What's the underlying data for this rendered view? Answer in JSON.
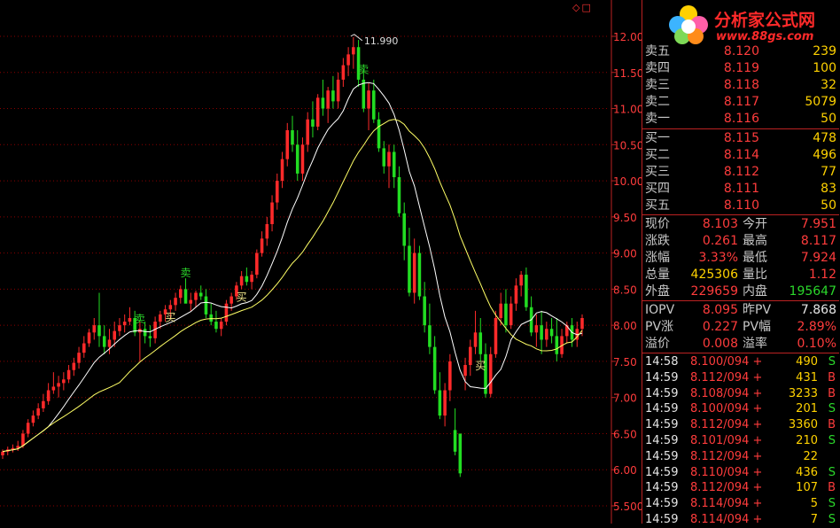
{
  "logo": {
    "title": "分析家公式网",
    "url": "www.88gs.com"
  },
  "header": {
    "top_right_icons": [
      "diamond-icon",
      "square-icon"
    ]
  },
  "chart_data": {
    "type": "candlestick",
    "ylim": [
      5.4,
      12.3
    ],
    "yticks": [
      12.0,
      11.5,
      11.0,
      10.5,
      10.0,
      9.5,
      9.0,
      8.5,
      8.0,
      7.5,
      7.0,
      6.5,
      6.0,
      5.5
    ],
    "ytick_labels": [
      "12.00",
      "11.50",
      "11.00",
      "10.50",
      "10.00",
      "9.50",
      "9.00",
      "8.50",
      "8.00",
      "7.50",
      "7.00",
      "6.50",
      "6.00",
      "5.500"
    ],
    "annotations": [
      {
        "text": "11.990",
        "x": 69,
        "y": 11.99
      },
      {
        "text": "卖",
        "x": 27,
        "y": 8.1,
        "kind": "sell"
      },
      {
        "text": "买",
        "x": 33,
        "y": 8.12,
        "kind": "buy"
      },
      {
        "text": "卖",
        "x": 36,
        "y": 8.74,
        "kind": "sell"
      },
      {
        "text": "买",
        "x": 47,
        "y": 8.4,
        "kind": "buy"
      },
      {
        "text": "卖",
        "x": 71,
        "y": 11.55,
        "kind": "sell"
      },
      {
        "text": "买",
        "x": 94,
        "y": 7.45,
        "kind": "buy"
      }
    ],
    "candles": [
      [
        6.2,
        6.28,
        6.15,
        6.25
      ],
      [
        6.25,
        6.32,
        6.2,
        6.28
      ],
      [
        6.28,
        6.35,
        6.24,
        6.3
      ],
      [
        6.3,
        6.4,
        6.26,
        6.33
      ],
      [
        6.33,
        6.55,
        6.3,
        6.5
      ],
      [
        6.5,
        6.7,
        6.45,
        6.65
      ],
      [
        6.65,
        6.82,
        6.6,
        6.75
      ],
      [
        6.75,
        6.92,
        6.7,
        6.85
      ],
      [
        6.85,
        7.05,
        6.8,
        6.95
      ],
      [
        6.95,
        7.2,
        6.9,
        7.1
      ],
      [
        7.1,
        7.35,
        7.05,
        7.15
      ],
      [
        7.15,
        7.3,
        7.0,
        7.2
      ],
      [
        7.2,
        7.35,
        7.1,
        7.25
      ],
      [
        7.25,
        7.45,
        7.2,
        7.38
      ],
      [
        7.38,
        7.55,
        7.3,
        7.48
      ],
      [
        7.48,
        7.7,
        7.4,
        7.62
      ],
      [
        7.62,
        7.85,
        7.55,
        7.75
      ],
      [
        7.75,
        7.95,
        7.7,
        7.9
      ],
      [
        7.9,
        8.1,
        7.8,
        8.0
      ],
      [
        8.0,
        8.45,
        7.7,
        7.85
      ],
      [
        7.85,
        8.0,
        7.6,
        7.7
      ],
      [
        7.7,
        7.95,
        7.6,
        7.8
      ],
      [
        7.8,
        8.05,
        7.7,
        7.92
      ],
      [
        7.92,
        8.1,
        7.85,
        8.0
      ],
      [
        8.0,
        8.15,
        7.9,
        8.05
      ],
      [
        8.05,
        8.25,
        8.0,
        8.1
      ],
      [
        8.1,
        8.2,
        7.85,
        7.9
      ],
      [
        7.9,
        8.05,
        7.5,
        7.95
      ],
      [
        7.95,
        8.05,
        7.75,
        7.85
      ],
      [
        7.85,
        8.0,
        7.7,
        7.82
      ],
      [
        7.82,
        8.12,
        7.75,
        8.05
      ],
      [
        8.05,
        8.2,
        7.95,
        8.15
      ],
      [
        8.15,
        8.28,
        8.05,
        8.22
      ],
      [
        8.22,
        8.35,
        8.1,
        8.28
      ],
      [
        8.28,
        8.45,
        8.2,
        8.38
      ],
      [
        8.38,
        8.55,
        8.3,
        8.5
      ],
      [
        8.5,
        8.65,
        8.4,
        8.3
      ],
      [
        8.3,
        8.45,
        8.2,
        8.35
      ],
      [
        8.35,
        8.48,
        8.25,
        8.45
      ],
      [
        8.45,
        8.55,
        8.35,
        8.4
      ],
      [
        8.4,
        8.5,
        8.1,
        8.15
      ],
      [
        8.15,
        8.3,
        8.0,
        8.05
      ],
      [
        8.05,
        8.2,
        7.9,
        7.95
      ],
      [
        7.95,
        8.1,
        7.85,
        8.05
      ],
      [
        8.05,
        8.35,
        8.0,
        8.3
      ],
      [
        8.3,
        8.45,
        8.2,
        8.4
      ],
      [
        8.4,
        8.6,
        8.35,
        8.55
      ],
      [
        8.55,
        8.75,
        8.5,
        8.68
      ],
      [
        8.68,
        8.8,
        8.55,
        8.6
      ],
      [
        8.6,
        8.75,
        8.5,
        8.7
      ],
      [
        8.7,
        9.05,
        8.65,
        9.0
      ],
      [
        9.0,
        9.3,
        8.95,
        9.2
      ],
      [
        9.2,
        9.5,
        9.1,
        9.4
      ],
      [
        9.4,
        9.8,
        9.3,
        9.7
      ],
      [
        9.7,
        10.1,
        9.6,
        10.0
      ],
      [
        10.0,
        10.4,
        9.9,
        10.3
      ],
      [
        10.3,
        10.8,
        10.2,
        10.7
      ],
      [
        10.7,
        10.9,
        10.4,
        10.5
      ],
      [
        10.5,
        10.7,
        10.0,
        10.1
      ],
      [
        10.1,
        10.6,
        10.0,
        10.5
      ],
      [
        10.5,
        10.95,
        10.4,
        10.85
      ],
      [
        10.85,
        11.1,
        10.6,
        10.75
      ],
      [
        10.75,
        11.2,
        10.7,
        11.15
      ],
      [
        11.15,
        11.4,
        10.9,
        11.0
      ],
      [
        11.0,
        11.3,
        10.8,
        11.25
      ],
      [
        11.25,
        11.45,
        11.0,
        11.1
      ],
      [
        11.1,
        11.5,
        11.0,
        11.4
      ],
      [
        11.4,
        11.7,
        11.3,
        11.6
      ],
      [
        11.6,
        11.85,
        11.45,
        11.75
      ],
      [
        11.75,
        11.99,
        11.55,
        11.85
      ],
      [
        11.85,
        11.95,
        11.3,
        11.4
      ],
      [
        11.4,
        11.55,
        10.95,
        11.0
      ],
      [
        11.0,
        11.35,
        10.7,
        11.25
      ],
      [
        11.25,
        11.4,
        10.8,
        10.85
      ],
      [
        10.85,
        10.95,
        10.4,
        10.45
      ],
      [
        10.45,
        10.55,
        10.1,
        10.2
      ],
      [
        10.2,
        10.5,
        9.9,
        10.4
      ],
      [
        10.4,
        10.5,
        9.9,
        10.05
      ],
      [
        10.05,
        10.2,
        9.5,
        9.55
      ],
      [
        9.55,
        9.7,
        8.9,
        9.1
      ],
      [
        9.1,
        9.35,
        8.4,
        8.45
      ],
      [
        8.45,
        9.2,
        8.3,
        9.0
      ],
      [
        9.0,
        9.1,
        8.35,
        8.4
      ],
      [
        8.4,
        8.6,
        7.9,
        8.0
      ],
      [
        8.0,
        8.3,
        7.6,
        7.7
      ],
      [
        7.7,
        7.85,
        7.05,
        7.1
      ],
      [
        7.1,
        7.35,
        6.7,
        6.75
      ],
      [
        6.75,
        7.2,
        6.6,
        7.1
      ],
      [
        7.1,
        7.6,
        6.95,
        7.5
      ],
      [
        6.55,
        6.85,
        6.2,
        6.25
      ],
      [
        6.5,
        6.5,
        5.9,
        5.95
      ],
      [
        7.3,
        7.55,
        7.1,
        7.45
      ],
      [
        7.45,
        7.8,
        7.3,
        7.7
      ],
      [
        7.7,
        8.2,
        7.6,
        7.9
      ],
      [
        7.9,
        8.1,
        7.5,
        7.6
      ],
      [
        7.6,
        7.75,
        7.0,
        7.05
      ],
      [
        7.05,
        7.7,
        7.0,
        7.6
      ],
      [
        7.6,
        8.2,
        7.55,
        8.1
      ],
      [
        8.1,
        8.45,
        8.0,
        8.3
      ],
      [
        8.3,
        8.5,
        7.9,
        8.0
      ],
      [
        8.0,
        8.4,
        7.95,
        8.3
      ],
      [
        8.3,
        8.65,
        8.2,
        8.55
      ],
      [
        8.55,
        8.75,
        8.4,
        8.7
      ],
      [
        8.7,
        8.8,
        8.2,
        8.25
      ],
      [
        8.25,
        8.4,
        7.85,
        7.9
      ],
      [
        7.9,
        8.15,
        7.7,
        8.0
      ],
      [
        8.0,
        8.2,
        7.6,
        7.8
      ],
      [
        7.8,
        8.05,
        7.7,
        7.95
      ],
      [
        7.95,
        8.1,
        7.75,
        7.85
      ],
      [
        7.85,
        8.1,
        7.5,
        7.6
      ],
      [
        7.6,
        7.95,
        7.55,
        7.85
      ],
      [
        7.85,
        8.05,
        7.75,
        8.0
      ],
      [
        8.0,
        8.1,
        7.7,
        7.8
      ],
      [
        7.8,
        8.05,
        7.7,
        7.95
      ],
      [
        7.95,
        8.15,
        7.85,
        8.1
      ]
    ]
  },
  "quote": {
    "asks": [
      {
        "label": "卖五",
        "price": "8.120",
        "vol": "239"
      },
      {
        "label": "卖四",
        "price": "8.119",
        "vol": "100"
      },
      {
        "label": "卖三",
        "price": "8.118",
        "vol": "32"
      },
      {
        "label": "卖二",
        "price": "8.117",
        "vol": "5079"
      },
      {
        "label": "卖一",
        "price": "8.116",
        "vol": "50"
      }
    ],
    "bids": [
      {
        "label": "买一",
        "price": "8.115",
        "vol": "478"
      },
      {
        "label": "买二",
        "price": "8.114",
        "vol": "496"
      },
      {
        "label": "买三",
        "price": "8.112",
        "vol": "77"
      },
      {
        "label": "买四",
        "price": "8.111",
        "vol": "83"
      },
      {
        "label": "买五",
        "price": "8.110",
        "vol": "50"
      }
    ],
    "stats": [
      {
        "l1": "现价",
        "v1": "8.103",
        "c1": "red",
        "l2": "今开",
        "v2": "7.951",
        "c2": "red"
      },
      {
        "l1": "涨跌",
        "v1": "0.261",
        "c1": "red",
        "l2": "最高",
        "v2": "8.117",
        "c2": "red"
      },
      {
        "l1": "涨幅",
        "v1": "3.33%",
        "c1": "red",
        "l2": "最低",
        "v2": "7.924",
        "c2": "red"
      },
      {
        "l1": "总量",
        "v1": "425306",
        "c1": "yel",
        "l2": "量比",
        "v2": "1.12",
        "c2": "red"
      },
      {
        "l1": "外盘",
        "v1": "229659",
        "c1": "red",
        "l2": "内盘",
        "v2": "195647",
        "c2": "grn"
      }
    ],
    "iopv": [
      {
        "l1": "IOPV",
        "v1": "8.095",
        "c1": "red",
        "l2": "昨PV",
        "v2": "7.868",
        "c2": "wht"
      },
      {
        "l1": "PV涨",
        "v1": "0.227",
        "c1": "red",
        "l2": "PV幅",
        "v2": "2.89%",
        "c2": "red"
      },
      {
        "l1": "溢价",
        "v1": "0.008",
        "c1": "red",
        "l2": "溢率",
        "v2": "0.10%",
        "c2": "red"
      }
    ],
    "ticks": [
      {
        "time": "14:58",
        "price": "8.100/094 +",
        "vol": "490",
        "side": "S"
      },
      {
        "time": "14:59",
        "price": "8.112/094 +",
        "vol": "431",
        "side": "B"
      },
      {
        "time": "14:59",
        "price": "8.108/094 +",
        "vol": "3233",
        "side": "B"
      },
      {
        "time": "14:59",
        "price": "8.100/094 +",
        "vol": "201",
        "side": "S"
      },
      {
        "time": "14:59",
        "price": "8.112/094 +",
        "vol": "3360",
        "side": "B"
      },
      {
        "time": "14:59",
        "price": "8.101/094 +",
        "vol": "210",
        "side": "S"
      },
      {
        "time": "14:59",
        "price": "8.112/094 +",
        "vol": "22",
        "side": ""
      },
      {
        "time": "14:59",
        "price": "8.110/094 +",
        "vol": "436",
        "side": "S"
      },
      {
        "time": "14:59",
        "price": "8.112/094 +",
        "vol": "107",
        "side": "B"
      },
      {
        "time": "14:59",
        "price": "8.114/094 +",
        "vol": "5",
        "side": "S"
      },
      {
        "time": "14:59",
        "price": "8.114/094 +",
        "vol": "7",
        "side": "S"
      }
    ]
  },
  "colors": {
    "up": "#ff2a2a",
    "down": "#22dd22",
    "ma_fast": "#ffffff",
    "ma_slow": "#ffff66",
    "grid": "#8b0000"
  }
}
